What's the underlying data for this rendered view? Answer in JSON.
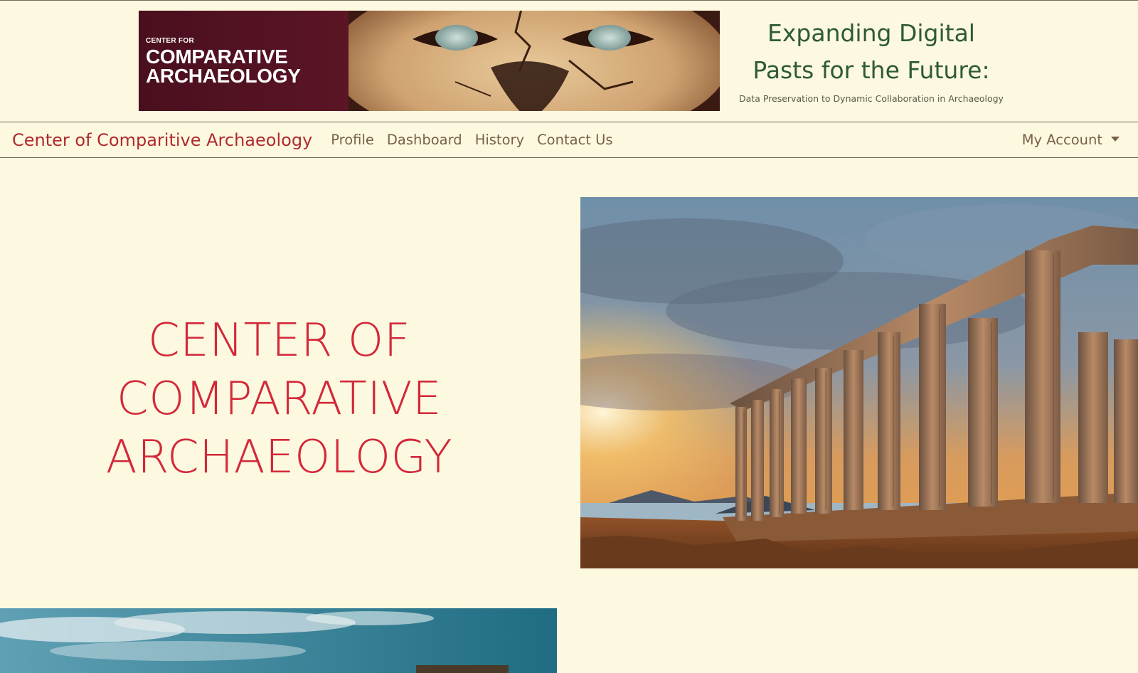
{
  "header": {
    "banner": {
      "logo_small": "CENTER FOR",
      "logo_line1": "COMPARATIVE",
      "logo_line2": "ARCHAEOLOGY"
    },
    "tagline_line1": "Expanding Digital",
    "tagline_line2": "Pasts for the Future:",
    "tagline_sub": "Data Preservation to Dynamic Collaboration in Archaeology"
  },
  "navbar": {
    "brand": "Center of Comparitive Archaeology",
    "links": [
      {
        "label": "Profile"
      },
      {
        "label": "Dashboard"
      },
      {
        "label": "History"
      },
      {
        "label": "Contact Us"
      }
    ],
    "account_label": "My Account"
  },
  "hero": {
    "title_line1": "CENTER OF",
    "title_line2": "COMPARATIVE",
    "title_line3": "ARCHAEOLOGY"
  },
  "colors": {
    "background": "#fcf9e0",
    "brand_red": "#b12a30",
    "hero_red": "#d3283a",
    "tagline_green": "#2f5a35",
    "nav_text": "#7a6048"
  }
}
